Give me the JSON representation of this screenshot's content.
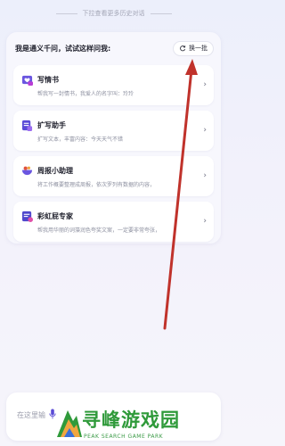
{
  "history_hint": "下拉查看更多历史对话",
  "prompt_panel": {
    "prompt_text": "我是通义千问，试试这样问我:",
    "refresh_label": "换一批",
    "cards": [
      {
        "title": "写情书",
        "desc": "帮我写一封情书，我爱人的名字叫：玲玲",
        "icon": "heart-letter-icon"
      },
      {
        "title": "扩写助手",
        "desc": "扩写文本，丰富内容：今天天气不错",
        "icon": "expand-doc-icon"
      },
      {
        "title": "周报小助理",
        "desc": "将工作概要整理成周报，依次罗列有数据的内容，",
        "icon": "report-bowl-icon"
      },
      {
        "title": "彩虹屁专家",
        "desc": "帮我用华丽的词藻润色夸奖文案，一定要非常夸张，",
        "icon": "rainbow-praise-icon"
      }
    ]
  },
  "input": {
    "placeholder": "在这里输"
  },
  "watermark": {
    "title": "寻峰游戏园",
    "subtitle": "PEAK SEARCH GAME PARK"
  },
  "colors": {
    "accent": "#5a4bd6",
    "annotation_arrow": "#c0322b",
    "watermark_green": "#2f9a3a"
  }
}
